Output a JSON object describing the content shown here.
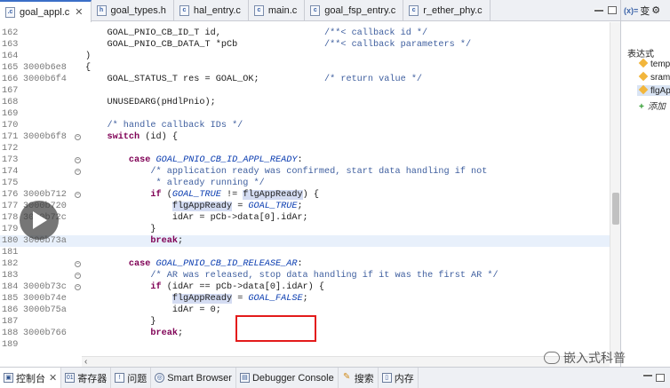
{
  "editor_tabs": [
    {
      "label": "goal_appl.c",
      "active": true,
      "close": "✕"
    },
    {
      "label": "goal_types.h"
    },
    {
      "label": "hal_entry.c"
    },
    {
      "label": "main.c"
    },
    {
      "label": "goal_fsp_entry.c"
    },
    {
      "label": "r_ether_phy.c"
    }
  ],
  "code_lines": [
    {
      "ln": "162",
      "addr": "",
      "code": "    GOAL_PNIO_CB_ID_T id,                   /**< callback id */"
    },
    {
      "ln": "163",
      "addr": "",
      "code": "    GOAL_PNIO_CB_DATA_T *pCb                /**< callback parameters */"
    },
    {
      "ln": "164",
      "addr": "",
      "code": ")"
    },
    {
      "ln": "165",
      "addr": "3000b6e8",
      "code": "{"
    },
    {
      "ln": "166",
      "addr": "3000b6f4",
      "code": "    GOAL_STATUS_T res = GOAL_OK;            /* return value */"
    },
    {
      "ln": "167",
      "addr": "",
      "code": ""
    },
    {
      "ln": "168",
      "addr": "",
      "code": "    UNUSEDARG(pHdlPnio);"
    },
    {
      "ln": "169",
      "addr": "",
      "code": ""
    },
    {
      "ln": "170",
      "addr": "",
      "code": "    /* handle callback IDs */"
    },
    {
      "ln": "171",
      "addr": "3000b6f8",
      "code": "    switch (id) {"
    },
    {
      "ln": "172",
      "addr": "",
      "code": ""
    },
    {
      "ln": "173",
      "addr": "",
      "code": "        case GOAL_PNIO_CB_ID_APPL_READY:"
    },
    {
      "ln": "174",
      "addr": "",
      "code": "            /* application ready was confirmed, start data handling if not"
    },
    {
      "ln": "175",
      "addr": "",
      "code": "             * already running */"
    },
    {
      "ln": "176",
      "addr": "3000b712",
      "code": "            if (GOAL_TRUE != flgAppReady) {"
    },
    {
      "ln": "177",
      "addr": "3000b720",
      "code": "                flgAppReady = GOAL_TRUE;"
    },
    {
      "ln": "178",
      "addr": "3000b72c",
      "code": "                idAr = pCb->data[0].idAr;"
    },
    {
      "ln": "179",
      "addr": "",
      "code": "            }"
    },
    {
      "ln": "180",
      "addr": "3000b73a",
      "code": "            break;"
    },
    {
      "ln": "181",
      "addr": "",
      "code": ""
    },
    {
      "ln": "182",
      "addr": "",
      "code": "        case GOAL_PNIO_CB_ID_RELEASE_AR:"
    },
    {
      "ln": "183",
      "addr": "",
      "code": "            /* AR was released, stop data handling if it was the first AR */"
    },
    {
      "ln": "184",
      "addr": "3000b73c",
      "code": "            if (idAr == pCb->data[0].idAr) {"
    },
    {
      "ln": "185",
      "addr": "3000b74e",
      "code": "                flgAppReady = GOAL_FALSE;"
    },
    {
      "ln": "186",
      "addr": "3000b75a",
      "code": "                idAr = 0;"
    },
    {
      "ln": "187",
      "addr": "",
      "code": "            }"
    },
    {
      "ln": "188",
      "addr": "3000b766",
      "code": "            break;"
    },
    {
      "ln": "189",
      "addr": "",
      "code": ""
    }
  ],
  "right_panel": {
    "tabs": [
      "(x)=",
      "变",
      "⚙"
    ],
    "section_label": "表达式",
    "items": [
      "temp",
      "sram",
      "flgAp"
    ],
    "add_label": "添加"
  },
  "bottom_tabs": [
    {
      "label": "控制台",
      "icon": "console-icon",
      "close": "✕"
    },
    {
      "label": "寄存器",
      "icon": "registers-icon"
    },
    {
      "label": "问题",
      "icon": "problems-icon"
    },
    {
      "label": "Smart Browser",
      "icon": "smart-browser-icon"
    },
    {
      "label": "Debugger Console",
      "icon": "debugger-console-icon"
    },
    {
      "label": "搜索",
      "icon": "search-icon"
    },
    {
      "label": "内存",
      "icon": "memory-icon"
    }
  ],
  "watermark": "嵌入式科普",
  "colors": {
    "keyword": "#7f0055",
    "comment": "#3f5f9f",
    "macro": "#0a3cb0",
    "highlight_box": "#e31b1b"
  }
}
